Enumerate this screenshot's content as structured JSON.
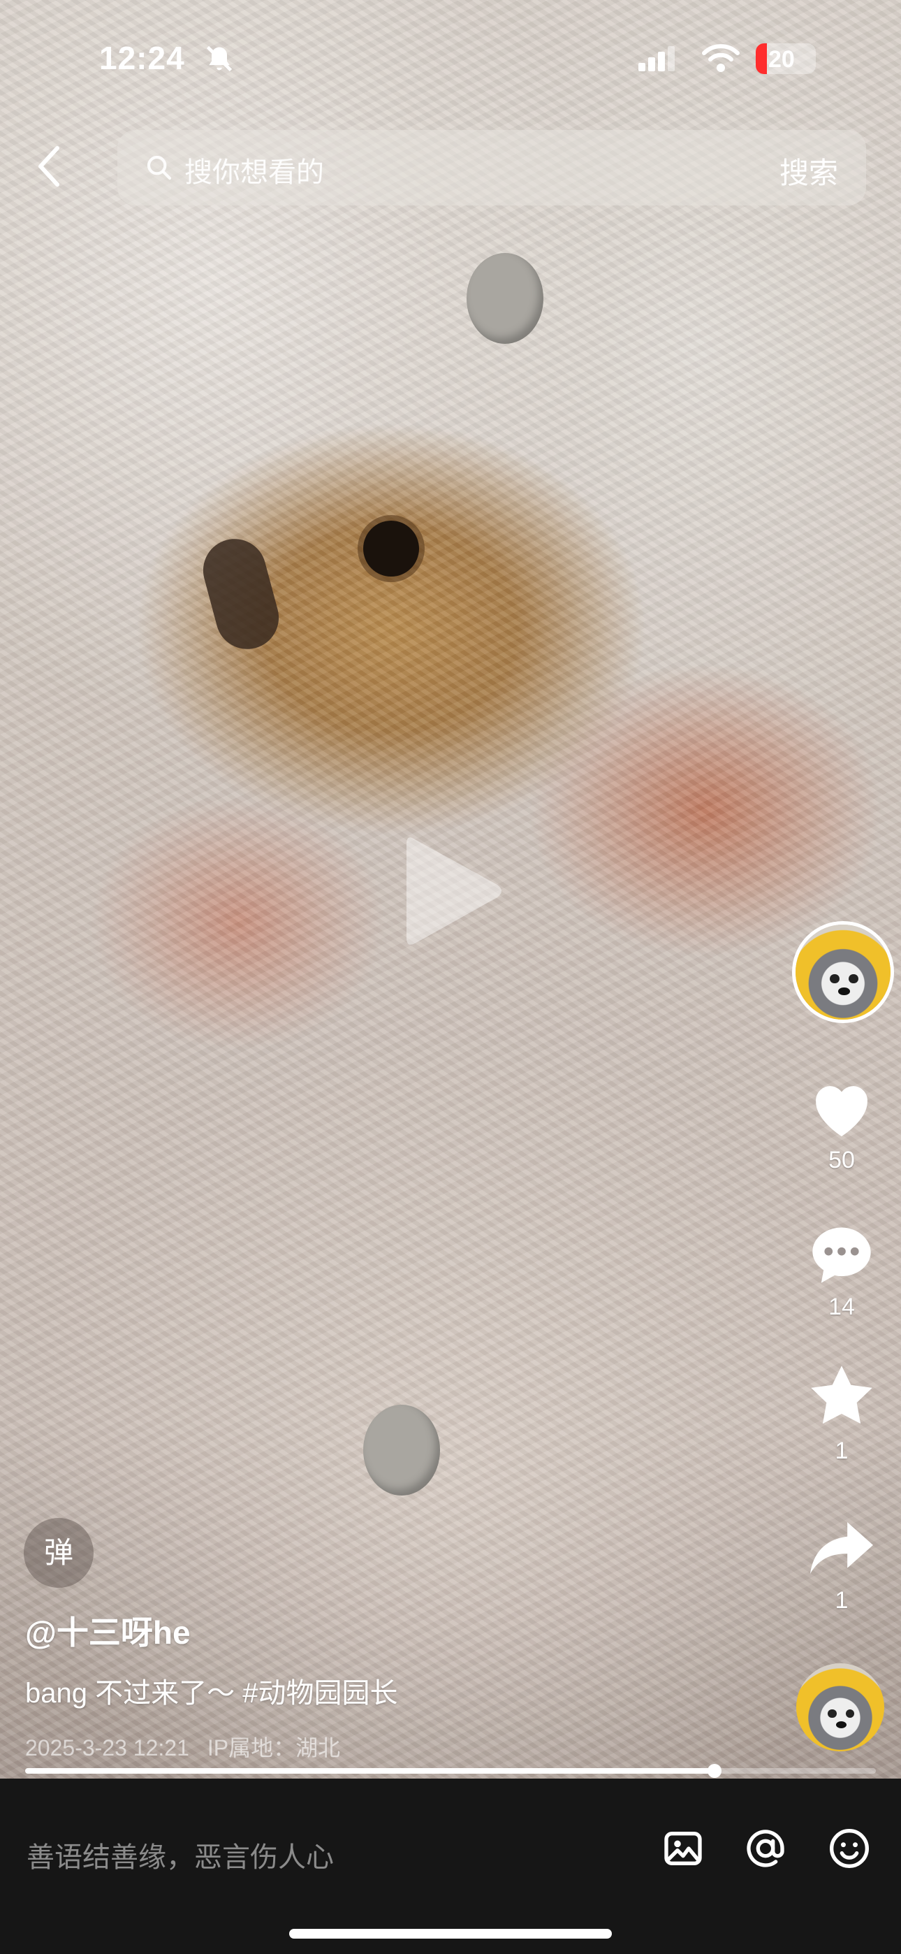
{
  "status_bar": {
    "time": "12:24",
    "battery": "20"
  },
  "search": {
    "placeholder": "搜你想看的",
    "button": "搜索"
  },
  "rail": {
    "likes": "50",
    "comments": "14",
    "favorites": "1",
    "shares": "1"
  },
  "video": {
    "danmu_label": "弹",
    "author": "@十三呀he",
    "description": "bang 不过来了～ #动物园园长",
    "date": "2025-3-23 12:21",
    "ip": "IP属地：湖北",
    "progress": 0.81
  },
  "comment_bar": {
    "placeholder": "善语结善缘，恶言伤人心"
  },
  "icons": [
    "back-icon",
    "search-icon",
    "bell-slash-icon",
    "signal-icon",
    "wifi-icon",
    "play-icon",
    "heart-icon",
    "comment-icon",
    "star-icon",
    "share-icon",
    "image-icon",
    "at-icon",
    "emoji-icon"
  ]
}
